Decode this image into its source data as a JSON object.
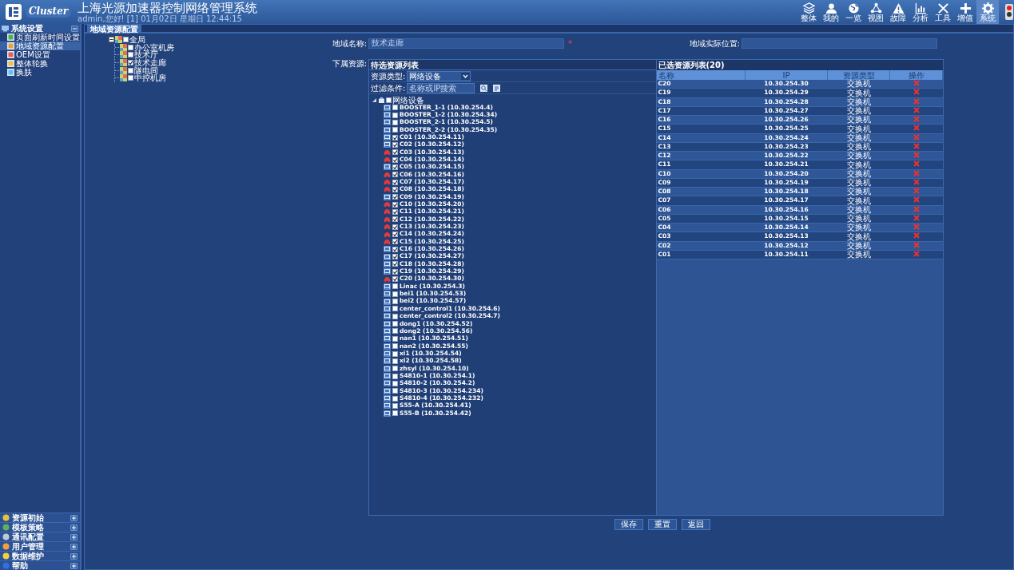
{
  "header": {
    "brand": "Cluster",
    "title": "上海光源加速器控制网络管理系统",
    "user_line": "admin,您好! [1] 01月02日 星期日 12:44:15"
  },
  "toolbar": [
    {
      "label": "整体",
      "selected": false
    },
    {
      "label": "我的",
      "selected": false
    },
    {
      "label": "一览",
      "selected": false
    },
    {
      "label": "视图",
      "selected": false
    },
    {
      "label": "故障",
      "selected": false
    },
    {
      "label": "分析",
      "selected": false
    },
    {
      "label": "工具",
      "selected": false
    },
    {
      "label": "增值",
      "selected": false
    },
    {
      "label": "系统",
      "selected": true
    }
  ],
  "sidebar": {
    "section": {
      "title": "系统设置",
      "expanded": true,
      "items": [
        {
          "label": "页面刷新时间设置",
          "selected": false
        },
        {
          "label": "地域资源配置",
          "selected": true
        },
        {
          "label": "OEM设置",
          "selected": false
        },
        {
          "label": "整体轮换",
          "selected": false
        },
        {
          "label": "换肤",
          "selected": false
        }
      ]
    },
    "accordions": [
      {
        "label": "资源初始",
        "expanded": false
      },
      {
        "label": "模板策略",
        "expanded": false
      },
      {
        "label": "通讯配置",
        "expanded": false
      },
      {
        "label": "用户管理",
        "expanded": false
      },
      {
        "label": "数据维护",
        "expanded": false
      },
      {
        "label": "帮助",
        "expanded": false
      }
    ]
  },
  "tabs": [
    {
      "label": "地域资源配置",
      "selected": true
    }
  ],
  "region_tree": {
    "label": "全局",
    "checked": false,
    "expanded": true,
    "children": [
      {
        "label": "办公室机房",
        "checked": false
      },
      {
        "label": "技术厅",
        "checked": false
      },
      {
        "label": "技术走廊",
        "checked": true
      },
      {
        "label": "隧电间",
        "checked": false
      },
      {
        "label": "中控机房",
        "checked": false
      }
    ]
  },
  "form": {
    "region_name": {
      "label": "地域名称:",
      "value": "技术走廊",
      "required_mark": "*"
    },
    "location": {
      "label": "地域实际位置:"
    },
    "resources_label": "下属资源:"
  },
  "candidates": {
    "title": "待选资源列表",
    "type_filter": {
      "label": "资源类型:",
      "value": "网络设备"
    },
    "search": {
      "label": "过滤条件:",
      "placeholder": "名称或IP搜索"
    },
    "tree": {
      "label": "网络设备",
      "checked": false,
      "expanded": true,
      "children": [
        {
          "label": "BOOSTER_1-1 (10.30.254.4)",
          "checked": false,
          "alarm": false
        },
        {
          "label": "BOOSTER_1-2 (10.30.254.34)",
          "checked": false,
          "alarm": false
        },
        {
          "label": "BOOSTER_2-1 (10.30.254.5)",
          "checked": false,
          "alarm": false
        },
        {
          "label": "BOOSTER_2-2 (10.30.254.35)",
          "checked": false,
          "alarm": false
        },
        {
          "label": "C01 (10.30.254.11)",
          "checked": true,
          "alarm": false
        },
        {
          "label": "C02 (10.30.254.12)",
          "checked": true,
          "alarm": false
        },
        {
          "label": "C03 (10.30.254.13)",
          "checked": true,
          "alarm": true
        },
        {
          "label": "C04 (10.30.254.14)",
          "checked": true,
          "alarm": true
        },
        {
          "label": "C05 (10.30.254.15)",
          "checked": true,
          "alarm": false
        },
        {
          "label": "C06 (10.30.254.16)",
          "checked": true,
          "alarm": true
        },
        {
          "label": "C07 (10.30.254.17)",
          "checked": true,
          "alarm": true
        },
        {
          "label": "C08 (10.30.254.18)",
          "checked": true,
          "alarm": true
        },
        {
          "label": "C09 (10.30.254.19)",
          "checked": true,
          "alarm": false
        },
        {
          "label": "C10 (10.30.254.20)",
          "checked": true,
          "alarm": true
        },
        {
          "label": "C11 (10.30.254.21)",
          "checked": true,
          "alarm": true
        },
        {
          "label": "C12 (10.30.254.22)",
          "checked": true,
          "alarm": true
        },
        {
          "label": "C13 (10.30.254.23)",
          "checked": true,
          "alarm": true
        },
        {
          "label": "C14 (10.30.254.24)",
          "checked": true,
          "alarm": true
        },
        {
          "label": "C15 (10.30.254.25)",
          "checked": true,
          "alarm": true
        },
        {
          "label": "C16 (10.30.254.26)",
          "checked": true,
          "alarm": false
        },
        {
          "label": "C17 (10.30.254.27)",
          "checked": true,
          "alarm": false
        },
        {
          "label": "C18 (10.30.254.28)",
          "checked": true,
          "alarm": false
        },
        {
          "label": "C19 (10.30.254.29)",
          "checked": true,
          "alarm": false
        },
        {
          "label": "C20 (10.30.254.30)",
          "checked": true,
          "alarm": true
        },
        {
          "label": "Linac (10.30.254.3)",
          "checked": false,
          "alarm": false
        },
        {
          "label": "bei1 (10.30.254.53)",
          "checked": false,
          "alarm": false
        },
        {
          "label": "bei2 (10.30.254.57)",
          "checked": false,
          "alarm": false
        },
        {
          "label": "center_control1 (10.30.254.6)",
          "checked": false,
          "alarm": false
        },
        {
          "label": "center_control2 (10.30.254.7)",
          "checked": false,
          "alarm": false
        },
        {
          "label": "dong1 (10.30.254.52)",
          "checked": false,
          "alarm": false
        },
        {
          "label": "dong2 (10.30.254.56)",
          "checked": false,
          "alarm": false
        },
        {
          "label": "nan1 (10.30.254.51)",
          "checked": false,
          "alarm": false
        },
        {
          "label": "nan2 (10.30.254.55)",
          "checked": false,
          "alarm": false
        },
        {
          "label": "xi1 (10.30.254.54)",
          "checked": false,
          "alarm": false
        },
        {
          "label": "xi2 (10.30.254.58)",
          "checked": false,
          "alarm": false
        },
        {
          "label": "zhsyl (10.30.254.10)",
          "checked": false,
          "alarm": false
        },
        {
          "label": "S4810-1 (10.30.254.1)",
          "checked": false,
          "alarm": false
        },
        {
          "label": "S4810-2 (10.30.254.2)",
          "checked": false,
          "alarm": false
        },
        {
          "label": "S4810-3 (10.30.254.234)",
          "checked": false,
          "alarm": false
        },
        {
          "label": "S4810-4 (10.30.254.232)",
          "checked": false,
          "alarm": false
        },
        {
          "label": "S55-A (10.30.254.41)",
          "checked": false,
          "alarm": false
        },
        {
          "label": "S55-B (10.30.254.42)",
          "checked": false,
          "alarm": false
        }
      ]
    }
  },
  "selected_list": {
    "title": "已选资源列表(20)",
    "columns": [
      "名称",
      "IP",
      "资源类型",
      "操作"
    ],
    "rows": [
      {
        "name": "C20",
        "ip": "10.30.254.30",
        "type": "交换机"
      },
      {
        "name": "C19",
        "ip": "10.30.254.29",
        "type": "交换机"
      },
      {
        "name": "C18",
        "ip": "10.30.254.28",
        "type": "交换机"
      },
      {
        "name": "C17",
        "ip": "10.30.254.27",
        "type": "交换机"
      },
      {
        "name": "C16",
        "ip": "10.30.254.26",
        "type": "交换机"
      },
      {
        "name": "C15",
        "ip": "10.30.254.25",
        "type": "交换机"
      },
      {
        "name": "C14",
        "ip": "10.30.254.24",
        "type": "交换机"
      },
      {
        "name": "C13",
        "ip": "10.30.254.23",
        "type": "交换机"
      },
      {
        "name": "C12",
        "ip": "10.30.254.22",
        "type": "交换机"
      },
      {
        "name": "C11",
        "ip": "10.30.254.21",
        "type": "交换机"
      },
      {
        "name": "C10",
        "ip": "10.30.254.20",
        "type": "交换机"
      },
      {
        "name": "C09",
        "ip": "10.30.254.19",
        "type": "交换机"
      },
      {
        "name": "C08",
        "ip": "10.30.254.18",
        "type": "交换机"
      },
      {
        "name": "C07",
        "ip": "10.30.254.17",
        "type": "交换机"
      },
      {
        "name": "C06",
        "ip": "10.30.254.16",
        "type": "交换机"
      },
      {
        "name": "C05",
        "ip": "10.30.254.15",
        "type": "交换机"
      },
      {
        "name": "C04",
        "ip": "10.30.254.14",
        "type": "交换机"
      },
      {
        "name": "C03",
        "ip": "10.30.254.13",
        "type": "交换机"
      },
      {
        "name": "C02",
        "ip": "10.30.254.12",
        "type": "交换机"
      },
      {
        "name": "C01",
        "ip": "10.30.254.11",
        "type": "交换机"
      }
    ]
  },
  "buttons": [
    {
      "label": "保存"
    },
    {
      "label": "重置"
    },
    {
      "label": "返回"
    }
  ]
}
